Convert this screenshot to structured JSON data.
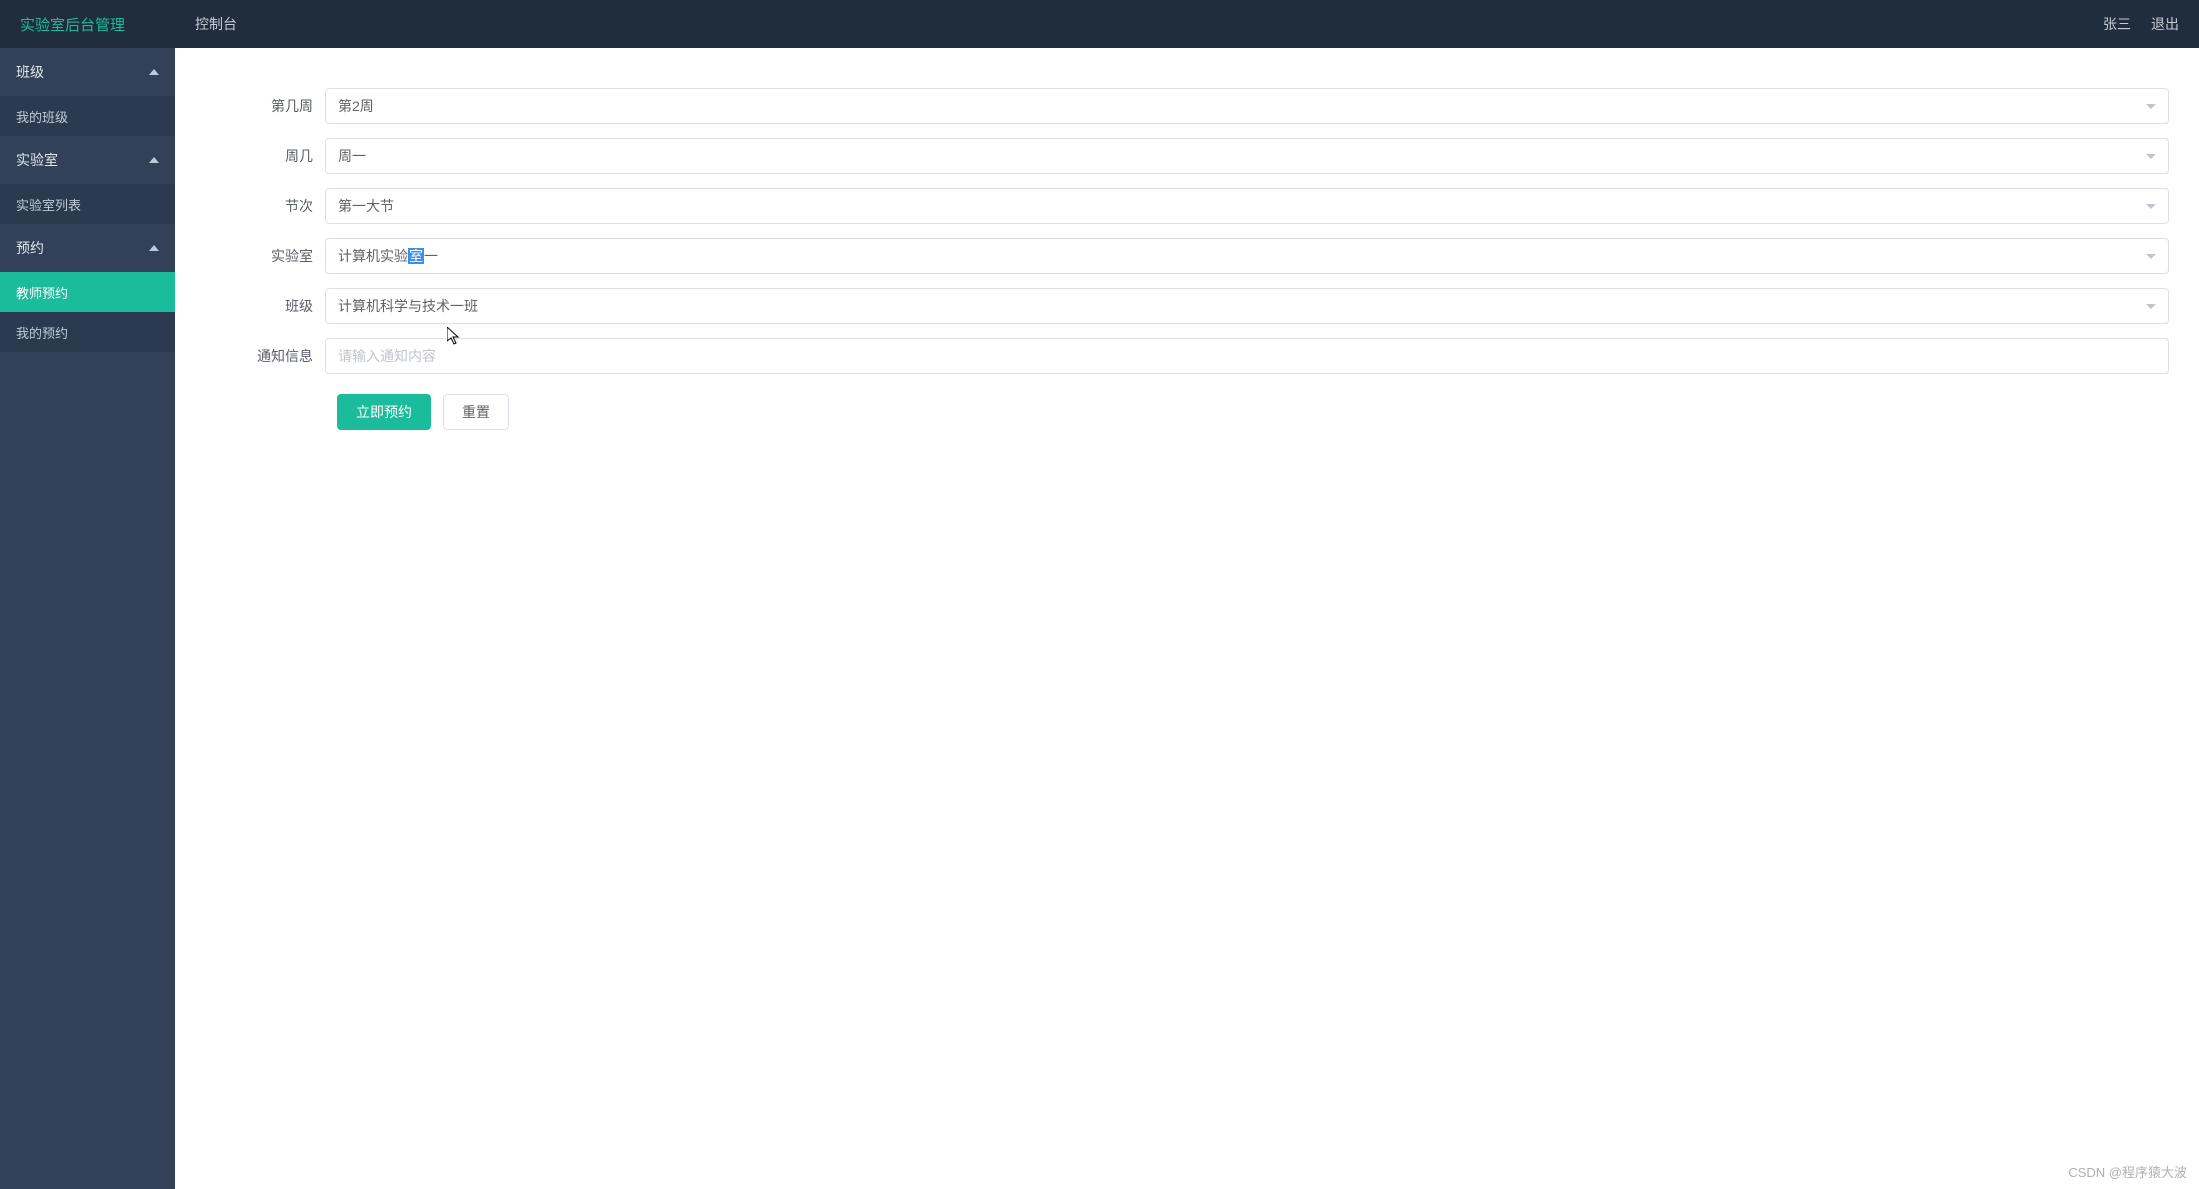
{
  "header": {
    "logo": "实验室后台管理",
    "nav_console": "控制台",
    "user_name": "张三",
    "logout": "退出"
  },
  "sidebar": {
    "groups": [
      {
        "title": "班级",
        "items": [
          {
            "label": "我的班级",
            "active": false
          }
        ]
      },
      {
        "title": "实验室",
        "items": [
          {
            "label": "实验室列表",
            "active": false
          }
        ]
      },
      {
        "title": "预约",
        "items": [
          {
            "label": "教师预约",
            "active": true
          },
          {
            "label": "我的预约",
            "active": false
          }
        ]
      }
    ]
  },
  "form": {
    "week": {
      "label": "第几周",
      "value": "第2周"
    },
    "day": {
      "label": "周几",
      "value": "周一"
    },
    "section": {
      "label": "节次",
      "value": "第一大节"
    },
    "lab": {
      "label": "实验室",
      "value_prefix": "计算机实验",
      "value_highlight": "室",
      "value_suffix": "一"
    },
    "class": {
      "label": "班级",
      "value": "计算机科学与技术一班"
    },
    "notice": {
      "label": "通知信息",
      "placeholder": "请输入通知内容"
    },
    "submit": "立即预约",
    "reset": "重置"
  },
  "watermark": "CSDN @程序猿大波"
}
